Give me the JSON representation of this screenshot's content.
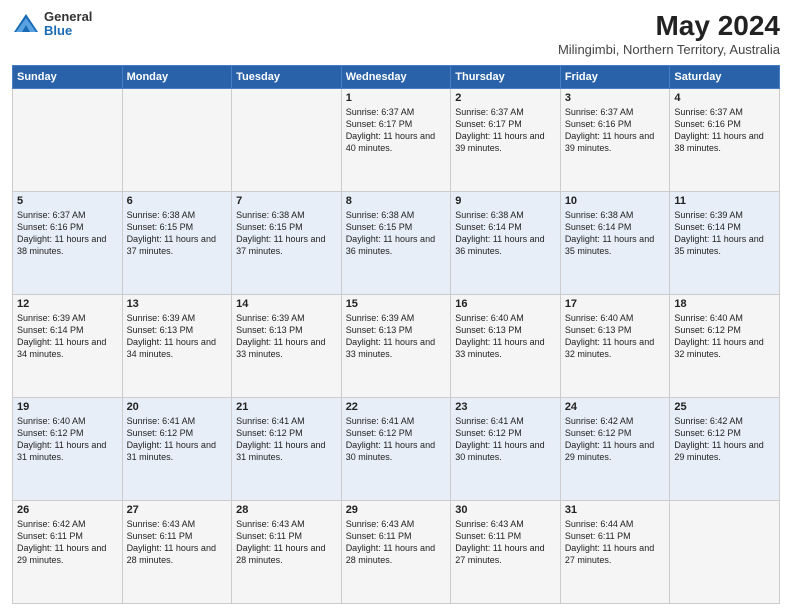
{
  "logo": {
    "general": "General",
    "blue": "Blue"
  },
  "title": "May 2024",
  "subtitle": "Milingimbi, Northern Territory, Australia",
  "days": [
    "Sunday",
    "Monday",
    "Tuesday",
    "Wednesday",
    "Thursday",
    "Friday",
    "Saturday"
  ],
  "weeks": [
    [
      {
        "day": "",
        "content": ""
      },
      {
        "day": "",
        "content": ""
      },
      {
        "day": "",
        "content": ""
      },
      {
        "day": "1",
        "content": "Sunrise: 6:37 AM\nSunset: 6:17 PM\nDaylight: 11 hours and 40 minutes."
      },
      {
        "day": "2",
        "content": "Sunrise: 6:37 AM\nSunset: 6:17 PM\nDaylight: 11 hours and 39 minutes."
      },
      {
        "day": "3",
        "content": "Sunrise: 6:37 AM\nSunset: 6:16 PM\nDaylight: 11 hours and 39 minutes."
      },
      {
        "day": "4",
        "content": "Sunrise: 6:37 AM\nSunset: 6:16 PM\nDaylight: 11 hours and 38 minutes."
      }
    ],
    [
      {
        "day": "5",
        "content": "Sunrise: 6:37 AM\nSunset: 6:16 PM\nDaylight: 11 hours and 38 minutes."
      },
      {
        "day": "6",
        "content": "Sunrise: 6:38 AM\nSunset: 6:15 PM\nDaylight: 11 hours and 37 minutes."
      },
      {
        "day": "7",
        "content": "Sunrise: 6:38 AM\nSunset: 6:15 PM\nDaylight: 11 hours and 37 minutes."
      },
      {
        "day": "8",
        "content": "Sunrise: 6:38 AM\nSunset: 6:15 PM\nDaylight: 11 hours and 36 minutes."
      },
      {
        "day": "9",
        "content": "Sunrise: 6:38 AM\nSunset: 6:14 PM\nDaylight: 11 hours and 36 minutes."
      },
      {
        "day": "10",
        "content": "Sunrise: 6:38 AM\nSunset: 6:14 PM\nDaylight: 11 hours and 35 minutes."
      },
      {
        "day": "11",
        "content": "Sunrise: 6:39 AM\nSunset: 6:14 PM\nDaylight: 11 hours and 35 minutes."
      }
    ],
    [
      {
        "day": "12",
        "content": "Sunrise: 6:39 AM\nSunset: 6:14 PM\nDaylight: 11 hours and 34 minutes."
      },
      {
        "day": "13",
        "content": "Sunrise: 6:39 AM\nSunset: 6:13 PM\nDaylight: 11 hours and 34 minutes."
      },
      {
        "day": "14",
        "content": "Sunrise: 6:39 AM\nSunset: 6:13 PM\nDaylight: 11 hours and 33 minutes."
      },
      {
        "day": "15",
        "content": "Sunrise: 6:39 AM\nSunset: 6:13 PM\nDaylight: 11 hours and 33 minutes."
      },
      {
        "day": "16",
        "content": "Sunrise: 6:40 AM\nSunset: 6:13 PM\nDaylight: 11 hours and 33 minutes."
      },
      {
        "day": "17",
        "content": "Sunrise: 6:40 AM\nSunset: 6:13 PM\nDaylight: 11 hours and 32 minutes."
      },
      {
        "day": "18",
        "content": "Sunrise: 6:40 AM\nSunset: 6:12 PM\nDaylight: 11 hours and 32 minutes."
      }
    ],
    [
      {
        "day": "19",
        "content": "Sunrise: 6:40 AM\nSunset: 6:12 PM\nDaylight: 11 hours and 31 minutes."
      },
      {
        "day": "20",
        "content": "Sunrise: 6:41 AM\nSunset: 6:12 PM\nDaylight: 11 hours and 31 minutes."
      },
      {
        "day": "21",
        "content": "Sunrise: 6:41 AM\nSunset: 6:12 PM\nDaylight: 11 hours and 31 minutes."
      },
      {
        "day": "22",
        "content": "Sunrise: 6:41 AM\nSunset: 6:12 PM\nDaylight: 11 hours and 30 minutes."
      },
      {
        "day": "23",
        "content": "Sunrise: 6:41 AM\nSunset: 6:12 PM\nDaylight: 11 hours and 30 minutes."
      },
      {
        "day": "24",
        "content": "Sunrise: 6:42 AM\nSunset: 6:12 PM\nDaylight: 11 hours and 29 minutes."
      },
      {
        "day": "25",
        "content": "Sunrise: 6:42 AM\nSunset: 6:12 PM\nDaylight: 11 hours and 29 minutes."
      }
    ],
    [
      {
        "day": "26",
        "content": "Sunrise: 6:42 AM\nSunset: 6:11 PM\nDaylight: 11 hours and 29 minutes."
      },
      {
        "day": "27",
        "content": "Sunrise: 6:43 AM\nSunset: 6:11 PM\nDaylight: 11 hours and 28 minutes."
      },
      {
        "day": "28",
        "content": "Sunrise: 6:43 AM\nSunset: 6:11 PM\nDaylight: 11 hours and 28 minutes."
      },
      {
        "day": "29",
        "content": "Sunrise: 6:43 AM\nSunset: 6:11 PM\nDaylight: 11 hours and 28 minutes."
      },
      {
        "day": "30",
        "content": "Sunrise: 6:43 AM\nSunset: 6:11 PM\nDaylight: 11 hours and 27 minutes."
      },
      {
        "day": "31",
        "content": "Sunrise: 6:44 AM\nSunset: 6:11 PM\nDaylight: 11 hours and 27 minutes."
      },
      {
        "day": "",
        "content": ""
      }
    ]
  ]
}
